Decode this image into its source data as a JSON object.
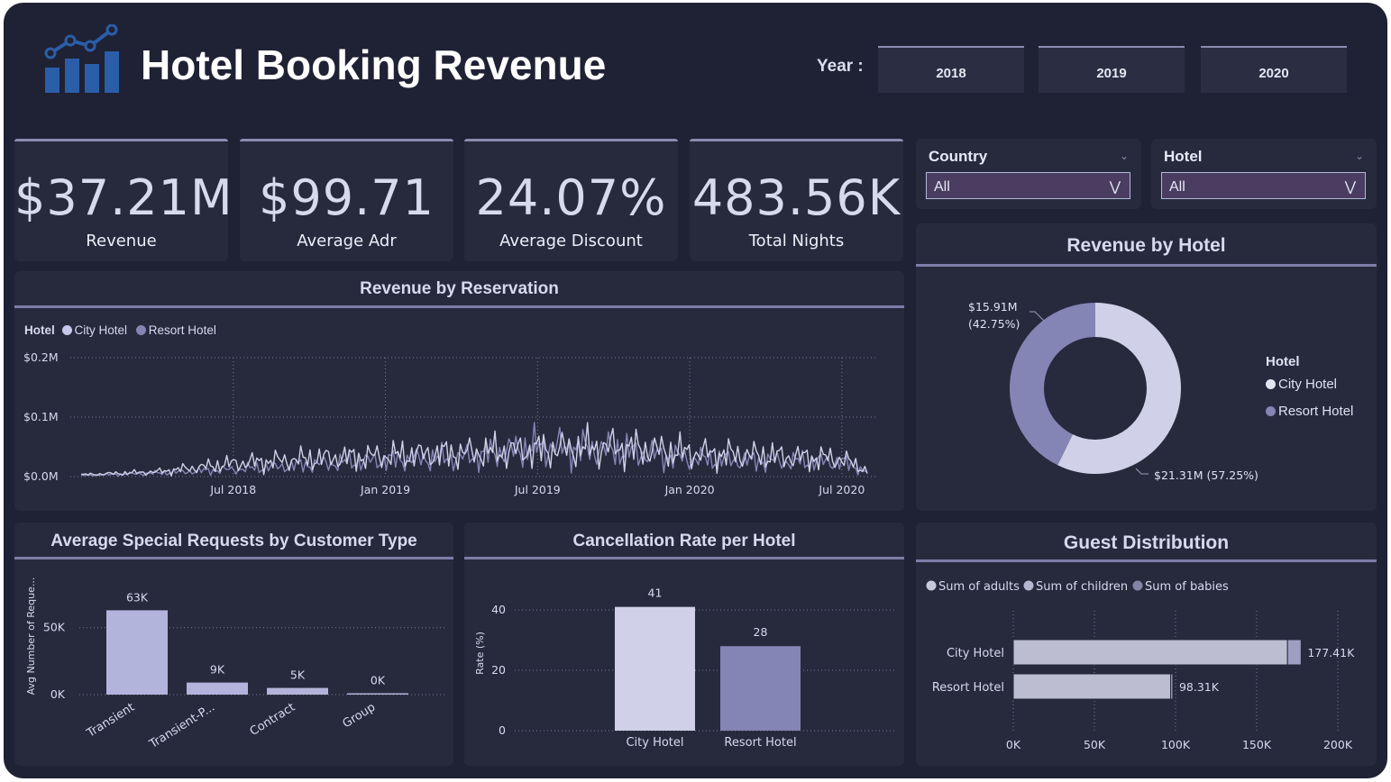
{
  "header": {
    "title": "Hotel Booking Revenue",
    "year_label": "Year :",
    "years": [
      "2018",
      "2019",
      "2020"
    ]
  },
  "kpis": [
    {
      "value": "$37.21M",
      "label": "Revenue"
    },
    {
      "value": "$99.71",
      "label": "Average Adr"
    },
    {
      "value": "24.07%",
      "label": "Average Discount"
    },
    {
      "value": "483.56K",
      "label": "Total Nights"
    }
  ],
  "filters": {
    "country": {
      "label": "Country",
      "value": "All"
    },
    "hotel": {
      "label": "Hotel",
      "value": "All"
    }
  },
  "colors": {
    "background": "#1f2134",
    "panel": "#272a3d",
    "city_hotel": "#d0d1e8",
    "resort_hotel": "#8485b5",
    "bar_light": "#b3b4db",
    "guest_bar": "#bcbdd0"
  },
  "icons": {
    "logo": "bar-chart-trend-icon",
    "chevron": "chevron-down-icon"
  },
  "revenue_by_reservation": {
    "title": "Revenue by Reservation",
    "legend_title": "Hotel",
    "legend": [
      "City Hotel",
      "Resort Hotel"
    ]
  },
  "revenue_by_hotel": {
    "title": "Revenue by Hotel",
    "legend_title": "Hotel",
    "legend": [
      "City Hotel",
      "Resort Hotel"
    ]
  },
  "special_requests": {
    "title": "Average Special Requests by Customer Type"
  },
  "cancellation": {
    "title": "Cancellation Rate per Hotel"
  },
  "guest_distribution": {
    "title": "Guest Distribution"
  },
  "chart_data": [
    {
      "id": "revenue_by_reservation",
      "type": "line",
      "title": "Revenue by Reservation",
      "xlabel": "",
      "ylabel": "",
      "x_ticks": [
        "Jul 2018",
        "Jan 2019",
        "Jul 2019",
        "Jan 2020",
        "Jul 2020"
      ],
      "y_ticks": [
        "$0.0M",
        "$0.1M",
        "$0.2M"
      ],
      "ylim": [
        0,
        0.2
      ],
      "x_range": [
        "2018-01",
        "2020-08"
      ],
      "grid": true,
      "legend_title": "Hotel",
      "legend_position": "top-left",
      "series": [
        {
          "name": "City Hotel",
          "x": [
            "2018-01",
            "2018-04",
            "2018-07",
            "2018-10",
            "2019-01",
            "2019-04",
            "2019-07",
            "2019-10",
            "2020-01",
            "2020-04",
            "2020-07",
            "2020-08"
          ],
          "values": [
            0.003,
            0.008,
            0.022,
            0.03,
            0.035,
            0.04,
            0.045,
            0.05,
            0.04,
            0.035,
            0.03,
            0.01
          ]
        },
        {
          "name": "Resort Hotel",
          "x": [
            "2018-01",
            "2018-04",
            "2018-07",
            "2018-10",
            "2019-01",
            "2019-04",
            "2019-07",
            "2019-10",
            "2020-01",
            "2020-04",
            "2020-07",
            "2020-08"
          ],
          "values": [
            0.002,
            0.006,
            0.012,
            0.02,
            0.028,
            0.032,
            0.05,
            0.045,
            0.03,
            0.026,
            0.025,
            0.008
          ]
        }
      ]
    },
    {
      "id": "revenue_by_hotel",
      "type": "pie",
      "title": "Revenue by Hotel",
      "legend_title": "Hotel",
      "legend_position": "right",
      "slices": [
        {
          "name": "City Hotel",
          "value": 21.31,
          "label": "$21.31M (57.25%)"
        },
        {
          "name": "Resort Hotel",
          "value": 15.91,
          "label": "$15.91M",
          "label2": "(42.75%)"
        }
      ]
    },
    {
      "id": "special_requests",
      "type": "bar",
      "title": "Average Special Requests by Customer Type",
      "xlabel": "",
      "ylabel": "Avg Number of Reque...",
      "categories": [
        "Transient",
        "Transient-P...",
        "Contract",
        "Group"
      ],
      "values": [
        63000,
        9000,
        5000,
        0
      ],
      "data_labels": [
        "63K",
        "9K",
        "5K",
        "0K"
      ],
      "y_ticks": [
        "0K",
        "50K"
      ],
      "ylim": [
        0,
        70000
      ],
      "grid": true
    },
    {
      "id": "cancellation",
      "type": "bar",
      "title": "Cancellation Rate per Hotel",
      "xlabel": "",
      "ylabel": "Rate (%)",
      "categories": [
        "City Hotel",
        "Resort Hotel"
      ],
      "values": [
        41,
        28
      ],
      "data_labels": [
        "41",
        "28"
      ],
      "y_ticks": [
        "0",
        "20",
        "40"
      ],
      "ylim": [
        0,
        45
      ],
      "grid": true
    },
    {
      "id": "guest_distribution",
      "type": "bar",
      "orientation": "horizontal",
      "title": "Guest Distribution",
      "categories": [
        "City Hotel",
        "Resort Hotel"
      ],
      "series": [
        {
          "name": "Sum of adults",
          "values": [
            169000,
            97000
          ]
        },
        {
          "name": "Sum of children",
          "values": [
            8410,
            1310
          ]
        },
        {
          "name": "Sum of babies",
          "values": [
            0,
            0
          ]
        }
      ],
      "totals": [
        "177.41K",
        "98.31K"
      ],
      "x_ticks": [
        "0K",
        "50K",
        "100K",
        "150K",
        "200K"
      ],
      "xlim": [
        0,
        200000
      ],
      "legend_position": "top-left",
      "grid": true
    }
  ]
}
